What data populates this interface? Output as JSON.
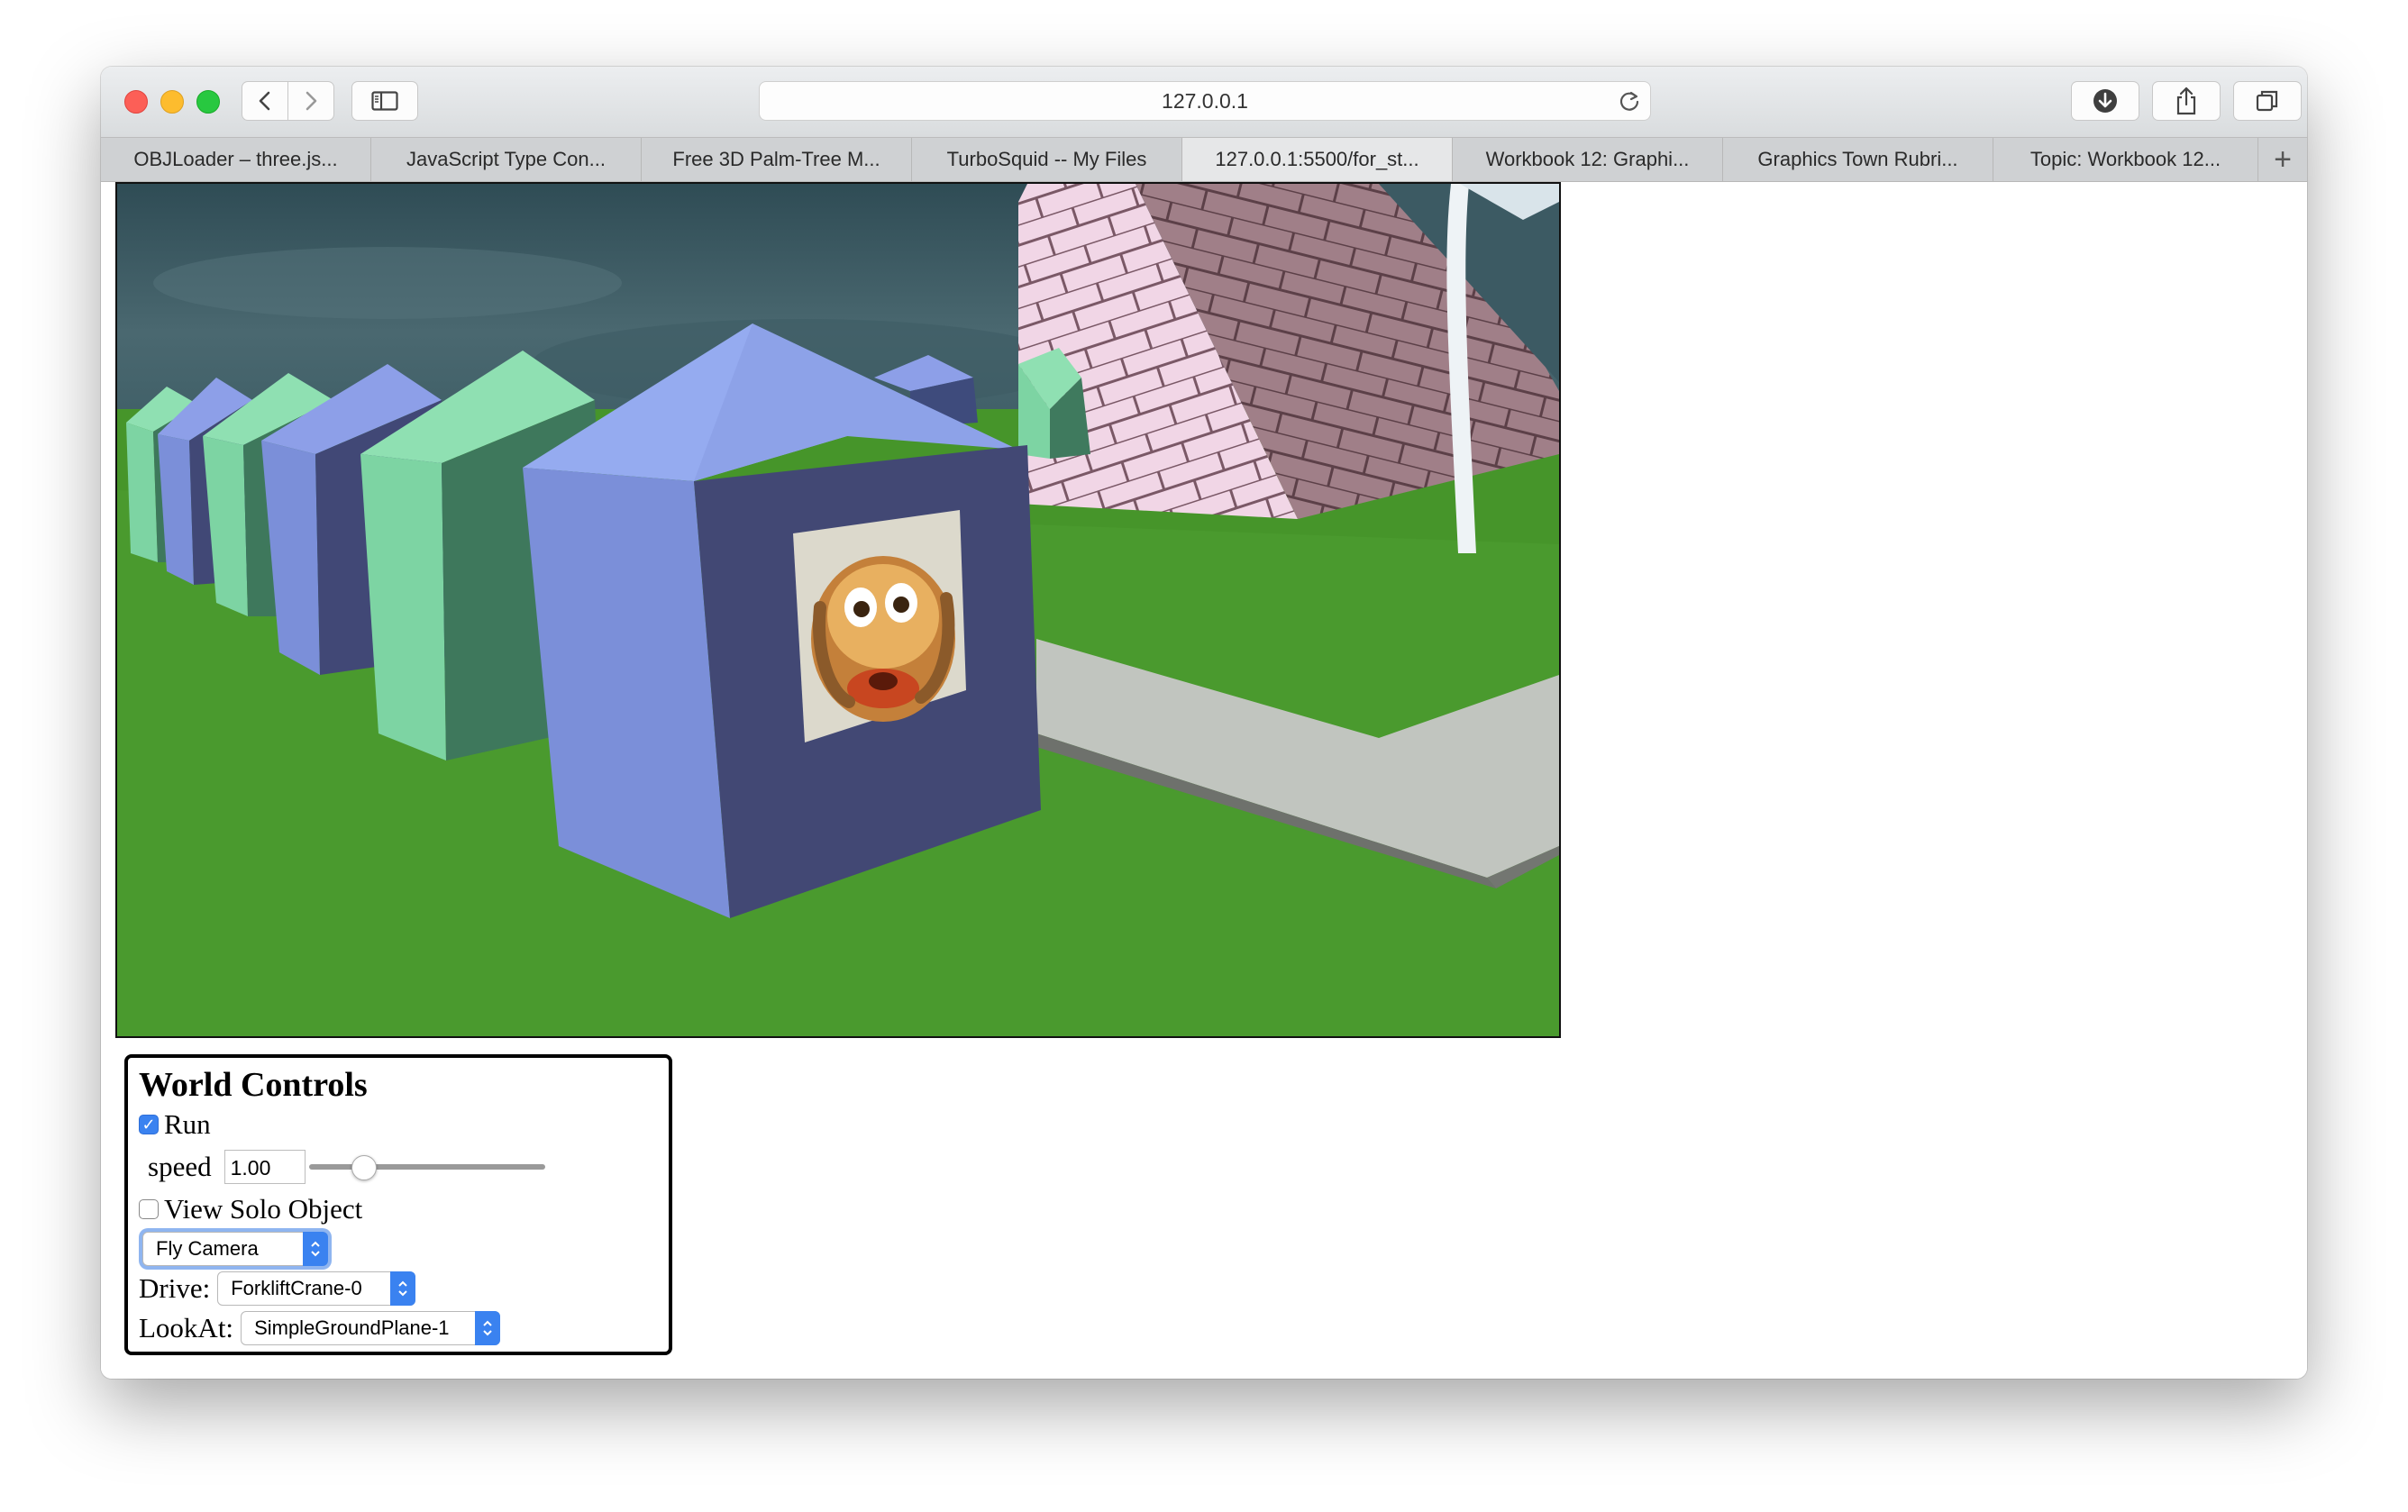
{
  "browser": {
    "address": "127.0.0.1",
    "tabs": [
      {
        "label": "OBJLoader – three.js..."
      },
      {
        "label": "JavaScript Type Con..."
      },
      {
        "label": "Free 3D Palm-Tree M..."
      },
      {
        "label": "TurboSquid -- My Files"
      },
      {
        "label": "127.0.0.1:5500/for_st...",
        "active": true
      },
      {
        "label": "Workbook 12: Graphi..."
      },
      {
        "label": "Graphics Town Rubri..."
      },
      {
        "label": "Topic: Workbook 12..."
      }
    ],
    "new_tab_label": "+",
    "icons": [
      "back-icon",
      "forward-icon",
      "sidebar-icon",
      "reload-icon",
      "download-icon",
      "share-icon",
      "tabs-overview-icon"
    ]
  },
  "scene": {
    "colors": {
      "sky": "#3c5a63",
      "grass": "#4a9a2e",
      "path": "#c0c4bc",
      "pyramid": "#f0d2e2",
      "house_blue": "#7b8fd9",
      "house_green": "#85d8a8"
    }
  },
  "controls": {
    "title": "World Controls",
    "run_label": "Run",
    "run_checked": true,
    "speed_label": "speed",
    "speed_value": "1.00",
    "speed_fraction": 0.2,
    "solo_label": "View Solo Object",
    "solo_checked": false,
    "camera_select": "Fly Camera",
    "drive_label": "Drive:",
    "drive_select": "ForkliftCrane-0",
    "lookat_label": "LookAt:",
    "lookat_select": "SimpleGroundPlane-1"
  }
}
